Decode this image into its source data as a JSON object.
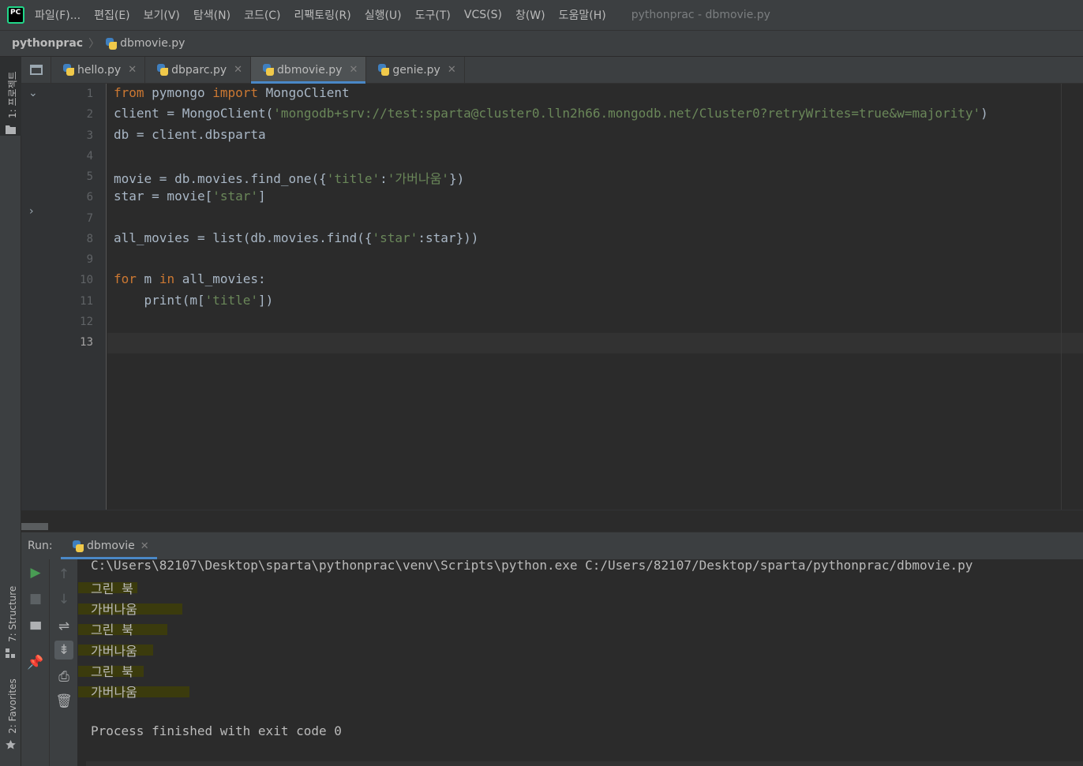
{
  "menubar": {
    "logo": "PC",
    "items": [
      "파일(F)...",
      "편집(E)",
      "보기(V)",
      "탐색(N)",
      "코드(C)",
      "리팩토링(R)",
      "실행(U)",
      "도구(T)",
      "VCS(S)",
      "창(W)",
      "도움말(H)"
    ],
    "window_title": "pythonprac - dbmovie.py"
  },
  "breadcrumb": {
    "project": "pythonprac",
    "file": "dbmovie.py"
  },
  "left_strip": {
    "project": "1: 프로젝트",
    "structure": "7: Structure",
    "favorites": "2: Favorites"
  },
  "tabs": [
    {
      "label": "hello.py",
      "active": false
    },
    {
      "label": "dbparc.py",
      "active": false
    },
    {
      "label": "dbmovie.py",
      "active": true
    },
    {
      "label": "genie.py",
      "active": false
    }
  ],
  "editor": {
    "current_line": 13,
    "line_numbers": [
      "1",
      "2",
      "3",
      "4",
      "5",
      "6",
      "7",
      "8",
      "9",
      "10",
      "11",
      "12",
      "13"
    ],
    "code": [
      [
        {
          "t": "kw",
          "v": "from"
        },
        {
          "t": "n",
          "v": " pymongo "
        },
        {
          "t": "kw",
          "v": "import"
        },
        {
          "t": "n",
          "v": " MongoClient"
        }
      ],
      [
        {
          "t": "n",
          "v": "client = MongoClient("
        },
        {
          "t": "str",
          "v": "'mongodb+srv://test:sparta@cluster0.lln2h66.mongodb.net/Cluster0?retryWrites=true&w=majority'"
        },
        {
          "t": "n",
          "v": ")"
        }
      ],
      [
        {
          "t": "n",
          "v": "db = client.dbsparta"
        }
      ],
      [],
      [
        {
          "t": "n",
          "v": "movie = db.movies.find_one({"
        },
        {
          "t": "str",
          "v": "'title'"
        },
        {
          "t": "n",
          "v": ":"
        },
        {
          "t": "str",
          "v": "'가버나움'"
        },
        {
          "t": "n",
          "v": "})"
        }
      ],
      [
        {
          "t": "n",
          "v": "star = movie["
        },
        {
          "t": "str",
          "v": "'star'"
        },
        {
          "t": "n",
          "v": "]"
        }
      ],
      [],
      [
        {
          "t": "n",
          "v": "all_movies = list(db.movies.find({"
        },
        {
          "t": "str",
          "v": "'star'"
        },
        {
          "t": "n",
          "v": ":star}))"
        }
      ],
      [],
      [
        {
          "t": "kw",
          "v": "for"
        },
        {
          "t": "n",
          "v": " m "
        },
        {
          "t": "kw",
          "v": "in"
        },
        {
          "t": "n",
          "v": " all_movies:"
        }
      ],
      [
        {
          "t": "n",
          "v": "    print(m["
        },
        {
          "t": "str",
          "v": "'title'"
        },
        {
          "t": "n",
          "v": "])"
        }
      ],
      [],
      []
    ]
  },
  "run": {
    "label": "Run:",
    "tab": "dbmovie",
    "command": "C:\\Users\\82107\\Desktop\\sparta\\pythonprac\\venv\\Scripts\\python.exe C:/Users/82107/Desktop/sparta/pythonprac/dbmovie.py",
    "output": [
      "그린 북",
      "가버나움",
      "그린 북",
      "가버나움",
      "그린 북",
      "가버나움"
    ],
    "exit_message": "Process finished with exit code 0"
  }
}
